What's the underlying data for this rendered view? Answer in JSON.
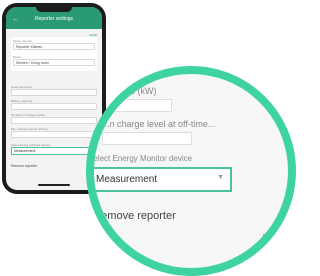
{
  "app": {
    "title": "Reporter settings",
    "back_icon": "arrow-left-icon",
    "save_label": "SAVE",
    "accent": "#2a9a74",
    "highlight": "#3fd2a2"
  },
  "form": {
    "name_label": "Name reporter",
    "name_value": "Reporter Kitchen",
    "room_label": "Room",
    "room_value": "Kitchen / Living room",
    "fields": [
      {
        "label": "Heat loss factor"
      },
      {
        "label": "Battery capacity"
      },
      {
        "label": "Number of chargers (kW)"
      },
      {
        "label": "Min. charge level at off-time..."
      }
    ],
    "zoom_fields": [
      {
        "label": "...gers (kW)"
      },
      {
        "label": "...n charge level at off-time..."
      }
    ],
    "device_label": "Select Energy Monitor device",
    "device_value": "Measurement",
    "remove_label": "Remove reporter",
    "remove_label_zoom": "...emove reporter"
  }
}
